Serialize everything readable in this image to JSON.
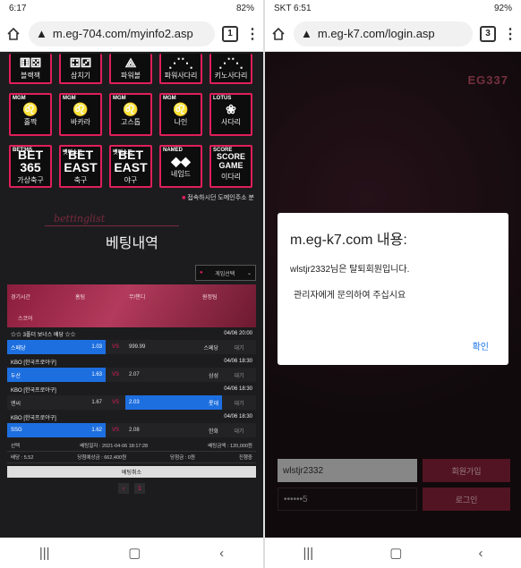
{
  "left": {
    "status": {
      "time": "6:17",
      "battery": "82%"
    },
    "url": "m.eg-704.com/myinfo2.asp",
    "tab_count": "1",
    "top_tiles": [
      {
        "label": "블랙잭",
        "icon": "dice-icon"
      },
      {
        "label": "삼치기",
        "icon": "dice-icon"
      },
      {
        "label": "파워볼",
        "icon": "tower-icon"
      },
      {
        "label": "파워사다리",
        "icon": "ladder-icon"
      },
      {
        "label": "키노사다리",
        "icon": "ladder-icon"
      }
    ],
    "tiles_row2": [
      {
        "tag": "MGM",
        "label": "홀짝"
      },
      {
        "tag": "MGM",
        "label": "바카라"
      },
      {
        "tag": "MGM",
        "label": "고스톱"
      },
      {
        "tag": "MGM",
        "label": "나인"
      },
      {
        "tag": "LOTUS",
        "label": "사다리"
      }
    ],
    "tiles_row3": [
      {
        "tag": "BET365",
        "icon": "BET 365",
        "label": "가상축구"
      },
      {
        "tag": "벳이스트",
        "icon": "BET EAST",
        "label": "축구"
      },
      {
        "tag": "벳이스트",
        "icon": "BET EAST",
        "label": "야구"
      },
      {
        "tag": "NAMED",
        "icon": "◆◆",
        "label": "네임드"
      },
      {
        "tag": "SCORE",
        "icon": "SCORE GAME",
        "label": "이다리"
      }
    ],
    "notice": "접속하시던 도메인주소 분",
    "bet_script": "bettinglist",
    "bet_title": "베팅내역",
    "select_label": "게임선택",
    "table_headers": [
      "경기시간",
      "홈팀",
      "무/핸디",
      "원정팀"
    ],
    "table_sub": "스코어",
    "groups": [
      {
        "title": "☆☆ 3폴더 보너스 배당 ☆☆",
        "time": "04/06 20:00",
        "home": "스페당",
        "home_odds": "1.03",
        "mid": "999.99",
        "away": "스페당",
        "status": "대기",
        "sel": "home"
      },
      {
        "title": "KBO [한국프로야구]",
        "time": "04/06 18:30",
        "home": "두산",
        "home_odds": "1.63",
        "mid": "2.07",
        "away": "삼성",
        "status": "대기",
        "sel": "home"
      },
      {
        "title": "KBO [한국프로야구]",
        "time": "04/06 18:30",
        "home": "엔씨",
        "home_odds": "1.67",
        "mid": "2.03",
        "away": "롯데",
        "status": "대기",
        "sel": "away"
      },
      {
        "title": "KBO [한국프로야구]",
        "time": "04/06 18:30",
        "home": "SSG",
        "home_odds": "1.62",
        "mid": "2.08",
        "away": "한화",
        "status": "대기",
        "sel": "home"
      }
    ],
    "info": {
      "line1": [
        "선택",
        "베팅일자 : 2021-04-06 18:17:28",
        "베팅금액 : 120,000원"
      ],
      "line2": [
        "배당 : 5.52",
        "당첨예상금 : 662,400원",
        "당첨금 : 0원",
        "진행중"
      ]
    },
    "cancel_label": "베팅취소",
    "pager": [
      "‹",
      "1"
    ]
  },
  "right": {
    "status": {
      "carrier": "SKT 6:51",
      "battery": "92%"
    },
    "url": "m.eg-k7.com/login.asp",
    "tab_count": "3",
    "logo": "EG337",
    "dialog": {
      "title": "m.eg-k7.com 내용:",
      "message1": "wlstjr2332님은 탈퇴회원입니다.",
      "message2": "관리자에게 문의하여 주십시요",
      "ok": "확인"
    },
    "login": {
      "id_value": "wlstjr2332",
      "pw_value": "••••••5",
      "join_label": "회원가입",
      "login_label": "로그인"
    }
  },
  "colors": {
    "accent": "#e01f5a",
    "select_blue": "#1d6fe0",
    "link": "#1a73e8"
  }
}
